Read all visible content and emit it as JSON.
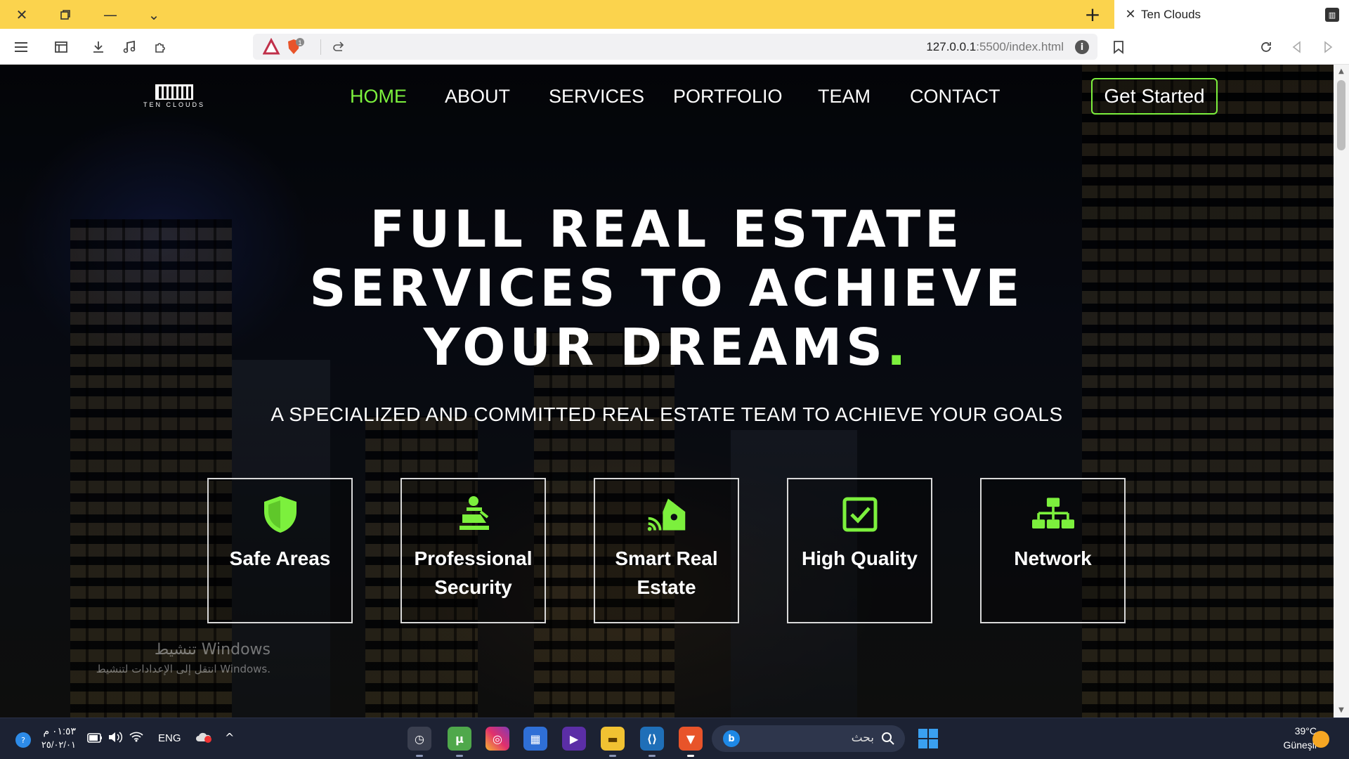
{
  "browser": {
    "tab_title": "Ten Clouds",
    "new_tab_symbol": "+",
    "url_host": "127.0.0.1",
    "url_path": ":5500/index.html",
    "shields_badge": "1"
  },
  "site": {
    "logo_text": "TEN CLOUDS",
    "nav": [
      {
        "label": "HOME",
        "active": true
      },
      {
        "label": "ABOUT",
        "active": false
      },
      {
        "label": "SERVICES",
        "active": false
      },
      {
        "label": "PORTFOLIO",
        "active": false
      },
      {
        "label": "TEAM",
        "active": false
      },
      {
        "label": "CONTACT",
        "active": false
      }
    ],
    "cta_label": "Get Started",
    "hero_line1": "FULL REAL ESTATE",
    "hero_line2": "SERVICES TO ACHIEVE",
    "hero_line3": "YOUR DREAMS",
    "hero_dot": ".",
    "hero_subtitle": "A SPECIALIZED AND COMMITTED REAL ESTATE TEAM TO ACHIEVE YOUR GOALS",
    "features": [
      {
        "label": "Safe Areas",
        "icon": "shield-icon"
      },
      {
        "label": "Professional Security",
        "icon": "security-guard-icon"
      },
      {
        "label": "Smart Real Estate",
        "icon": "smart-home-icon"
      },
      {
        "label": "High Quality",
        "icon": "checkbox-icon"
      },
      {
        "label": "Network",
        "icon": "network-icon"
      }
    ],
    "accent_color": "#7cf03d"
  },
  "watermark": {
    "line1": "تنشيط Windows",
    "line2": "انتقل إلى الإعدادات لتنشيط Windows."
  },
  "taskbar": {
    "time": "٠١:٥٣ م",
    "date": "٢٥/٠٢/٠١",
    "language": "ENG",
    "search_placeholder": "بحث",
    "weather_temp": "39°C",
    "weather_desc": "Güneşli"
  }
}
